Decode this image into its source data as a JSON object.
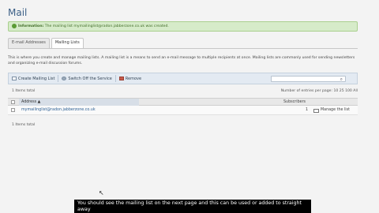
{
  "page": {
    "title": "Mail"
  },
  "banner": {
    "prefix": "Information:",
    "message": "The mailing list mymailinglist@radon.jabberzone.co.uk was created."
  },
  "tabs": [
    {
      "label": "E-mail Addresses",
      "active": false
    },
    {
      "label": "Mailing Lists",
      "active": true
    }
  ],
  "description": "This is where you create and manage mailing lists. A mailing list is a means to send an e-mail message to multiple recipients at once. Mailing lists are commonly used for sending newsletters and organizing e-mail discussion forums.",
  "toolbar": {
    "create_label": "Create Mailing List",
    "switch_off_label": "Switch Off the Service",
    "remove_label": "Remove",
    "search_placeholder": ""
  },
  "paging": {
    "items_total_top": "1 Items total",
    "items_total_bottom": "1 Items total",
    "entries_label": "Number of entries per page: 10 25 100 All"
  },
  "table": {
    "columns": [
      "Address",
      "Subscribers"
    ],
    "rows": [
      {
        "address": "mymailinglist@radon.jabberzone.co.uk",
        "subscribers": "1",
        "action": "Manage the list"
      }
    ]
  },
  "caption": {
    "text": "You should see the mailing list on the next page and this can be used or added to straight away"
  },
  "colors": {
    "accent": "#3b5f86",
    "success_bg": "#d6ebc9",
    "toolbar_bg": "#e3eaf2"
  }
}
